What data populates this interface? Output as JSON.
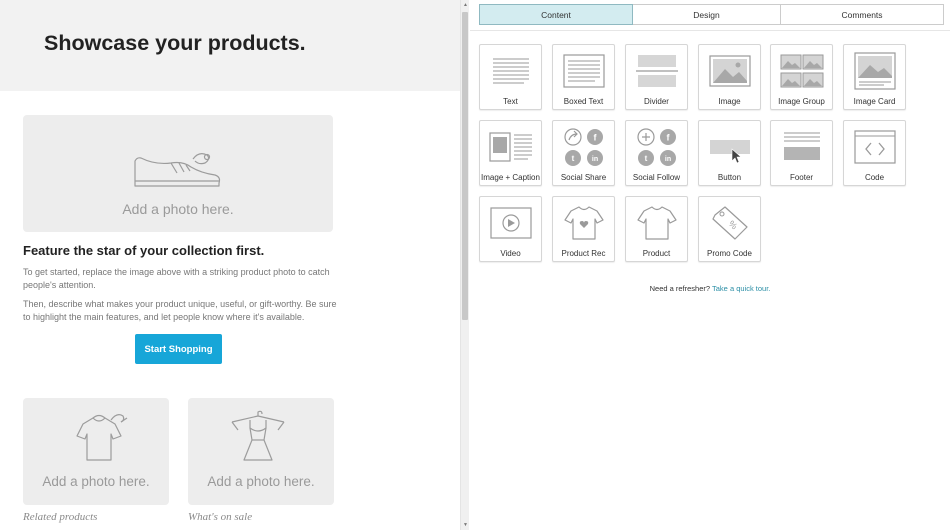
{
  "preview": {
    "heading": "Showcase your products.",
    "main_photo": {
      "placeholder": "Add a photo here.",
      "icon": "shoe-icon"
    },
    "feature_title": "Feature the star of your collection first.",
    "paragraph1": "To get started, replace the image above with a striking product photo to catch people's attention.",
    "paragraph2": "Then, describe what makes your product unique, useful, or gift-worthy. Be sure to highlight the main features, and let people know where it's available.",
    "button_label": "Start Shopping",
    "button_color": "#17a6d8",
    "photo_a": {
      "placeholder": "Add a photo here.",
      "icon": "tshirt-hanger-icon",
      "caption": "Related products"
    },
    "photo_b": {
      "placeholder": "Add a photo here.",
      "icon": "dress-hanger-icon",
      "caption": "What's on sale"
    }
  },
  "scrollbar": {
    "up_icon": "▲",
    "down_icon": "▼"
  },
  "panel": {
    "tabs": [
      {
        "label": "Content",
        "active": true
      },
      {
        "label": "Design",
        "active": false
      },
      {
        "label": "Comments",
        "active": false
      }
    ],
    "active_tab_color": "#d3ecf0",
    "blocks": [
      {
        "label": "Text",
        "icon": "text-block-icon"
      },
      {
        "label": "Boxed Text",
        "icon": "boxed-text-icon"
      },
      {
        "label": "Divider",
        "icon": "divider-icon"
      },
      {
        "label": "Image",
        "icon": "image-icon"
      },
      {
        "label": "Image Group",
        "icon": "image-group-icon"
      },
      {
        "label": "Image Card",
        "icon": "image-card-icon"
      },
      {
        "label": "Image + Caption",
        "icon": "image-caption-icon"
      },
      {
        "label": "Social Share",
        "icon": "social-share-icon"
      },
      {
        "label": "Social Follow",
        "icon": "social-follow-icon"
      },
      {
        "label": "Button",
        "icon": "button-block-icon"
      },
      {
        "label": "Footer",
        "icon": "footer-icon"
      },
      {
        "label": "Code",
        "icon": "code-icon"
      },
      {
        "label": "Video",
        "icon": "video-icon"
      },
      {
        "label": "Product Rec",
        "icon": "product-rec-icon"
      },
      {
        "label": "Product",
        "icon": "product-icon"
      },
      {
        "label": "Promo Code",
        "icon": "promo-code-icon"
      }
    ],
    "refresher_text": "Need a refresher?",
    "refresher_link": "Take a quick tour."
  }
}
